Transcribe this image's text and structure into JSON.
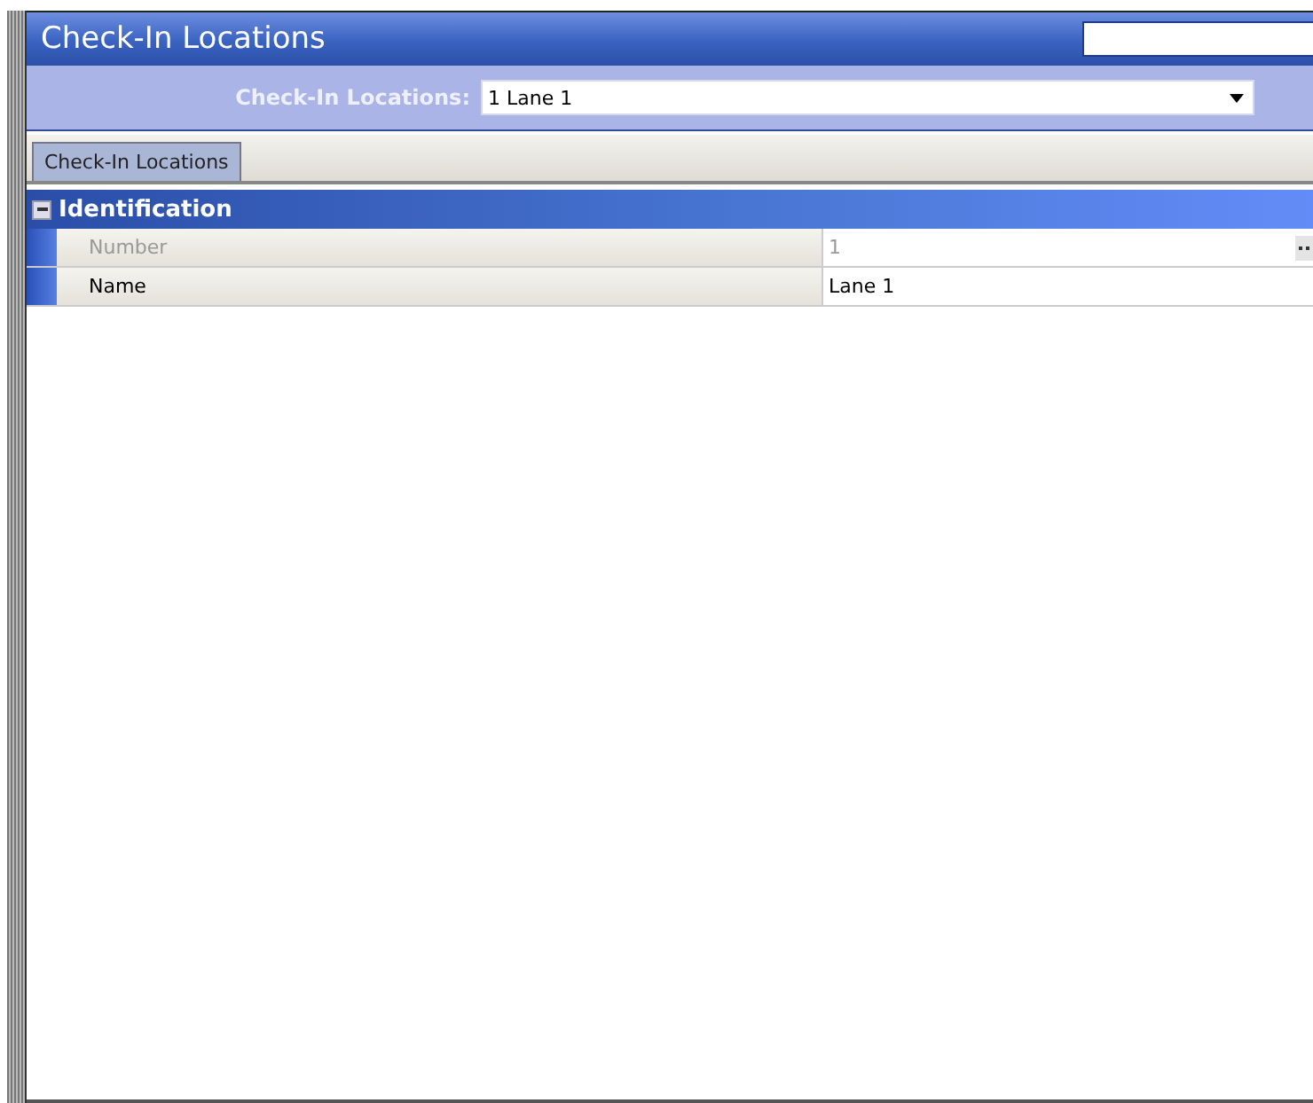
{
  "window": {
    "title": "Check-In Locations"
  },
  "selector": {
    "label": "Check-In Locations:",
    "value": "1 Lane 1"
  },
  "tabs": [
    {
      "label": "Check-In Locations",
      "selected": true
    }
  ],
  "group": {
    "title": "Identification",
    "expanded": true,
    "rows": [
      {
        "label": "Number",
        "value": "1",
        "disabled": true,
        "kind": "lookup"
      },
      {
        "label": "Name",
        "value": "Lane 1",
        "disabled": false,
        "kind": "text"
      }
    ]
  }
}
